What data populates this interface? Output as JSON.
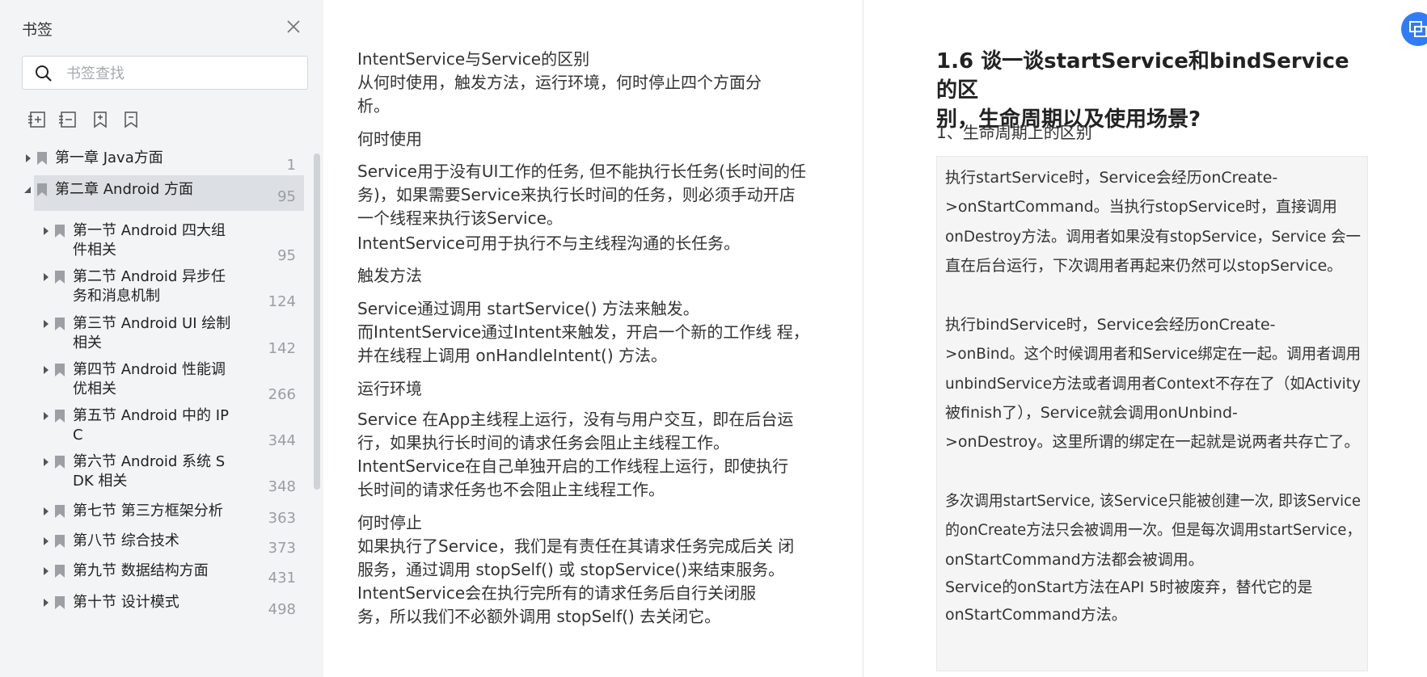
{
  "sidebar": {
    "title": "书签",
    "search_placeholder": "书签查找",
    "tree": [
      {
        "label_lines": [
          "第一章 Java方面"
        ],
        "page": "1",
        "level": 0,
        "expanded": false,
        "selected": false
      },
      {
        "label_lines": [
          "第二章 Android 方面"
        ],
        "page": "95",
        "level": 0,
        "expanded": true,
        "selected": true
      },
      {
        "label_lines": [
          "第一节 Android 四大组",
          "件相关"
        ],
        "page": "95",
        "level": 1,
        "expanded": false,
        "selected": false
      },
      {
        "label_lines": [
          "第二节 Android 异步任",
          "务和消息机制"
        ],
        "page": "124",
        "level": 1,
        "expanded": false,
        "selected": false
      },
      {
        "label_lines": [
          "第三节 Android UI 绘制",
          "相关"
        ],
        "page": "142",
        "level": 1,
        "expanded": false,
        "selected": false
      },
      {
        "label_lines": [
          "第四节 Android 性能调",
          "优相关"
        ],
        "page": "266",
        "level": 1,
        "expanded": false,
        "selected": false
      },
      {
        "label_lines": [
          "第五节 Android 中的 IP",
          "C"
        ],
        "page": "344",
        "level": 1,
        "expanded": false,
        "selected": false
      },
      {
        "label_lines": [
          "第六节 Android 系统 S",
          "DK 相关"
        ],
        "page": "348",
        "level": 1,
        "expanded": false,
        "selected": false
      },
      {
        "label_lines": [
          "第七节 第三方框架分析"
        ],
        "page": "363",
        "level": 1,
        "expanded": false,
        "selected": false
      },
      {
        "label_lines": [
          "第八节 综合技术"
        ],
        "page": "373",
        "level": 1,
        "expanded": false,
        "selected": false
      },
      {
        "label_lines": [
          "第九节 数据结构方面"
        ],
        "page": "431",
        "level": 1,
        "expanded": false,
        "selected": false
      },
      {
        "label_lines": [
          "第十节 设计模式"
        ],
        "page": "498",
        "level": 1,
        "expanded": false,
        "selected": false
      }
    ]
  },
  "left_page": {
    "lines": [
      "IntentService与Service的区别",
      "从何时使用，触发方法，运行环境，何时停止四个方面分",
      "析。",
      "何时使用",
      "Service用于没有UI工作的任务, 但不能执行长任务(长时间的任",
      "务)，如果需要Service来执行长时间的任务，则必须手动开店",
      "一个线程来执行该Service。",
      "IntentService可用于执行不与主线程沟通的长任务。",
      "触发方法",
      "Service通过调用  startService()  方法来触发。",
      "而IntentService通过Intent来触发，开启一个新的工作线   程，",
      "并在线程上调用  onHandleIntent() 方法。",
      "运行环境",
      "Service  在App主线程上运行，没有与用户交互，即在后台运",
      "行，如果执行长时间的请求任务会阻止主线程工作。",
      "IntentService在自己单独开启的工作线程上运行，即使执行",
      "长时间的请求任务也不会阻止主线程工作。",
      "何时停止",
      "如果执行了Service，我们是有责任在其请求任务完成后关  闭",
      "服务，通过调用  stopSelf() 或 stopService()来结束服务。",
      "IntentService会在执行完所有的请求任务后自行关闭服",
      "务，所以我们不必额外调用  stopSelf()  去关闭它。"
    ]
  },
  "right_page": {
    "heading_lines": [
      "1.6 谈一谈startService和bindService的区",
      "别，生命周期以及使用场景?"
    ],
    "subheading": "1、生命周期上的区别",
    "code_lines": [
      "执行startService时，Service会经历onCreate-",
      ">onStartCommand。当执行stopService时，直接调用",
      "onDestroy方法。调用者如果没有stopService，Service 会一",
      "直在后台运行，下次调用者再起来仍然可以stopService。",
      "执行bindService时，Service会经历onCreate-",
      ">onBind。这个时候调用者和Service绑定在一起。调用者调用",
      "unbindService方法或者调用者Context不存在了（如Activity",
      "被finish了），Service就会调用onUnbind-",
      ">onDestroy。这里所谓的绑定在一起就是说两者共存亡了。",
      "多次调用startService, 该Service只能被创建一次, 即该Service",
      "的onCreate方法只会被调用一次。但是每次调用startService，",
      "onStartCommand方法都会被调用。",
      "Service的onStart方法在API 5时被废弃，替代它的是",
      "onStartCommand方法。"
    ]
  },
  "colors": {
    "accent": "#2f7cf6",
    "selection": "#dcdfe3",
    "sidebar_bg": "#f3f4f6",
    "page_number": "#9a9da2"
  },
  "icons": [
    "close-icon",
    "search-icon",
    "add-bookmark-icon",
    "remove-bookmark-icon",
    "bookmark-add-icon",
    "bookmark-icon",
    "expand-caret-icon",
    "bookmark-item-icon",
    "floating-tool-icon"
  ]
}
